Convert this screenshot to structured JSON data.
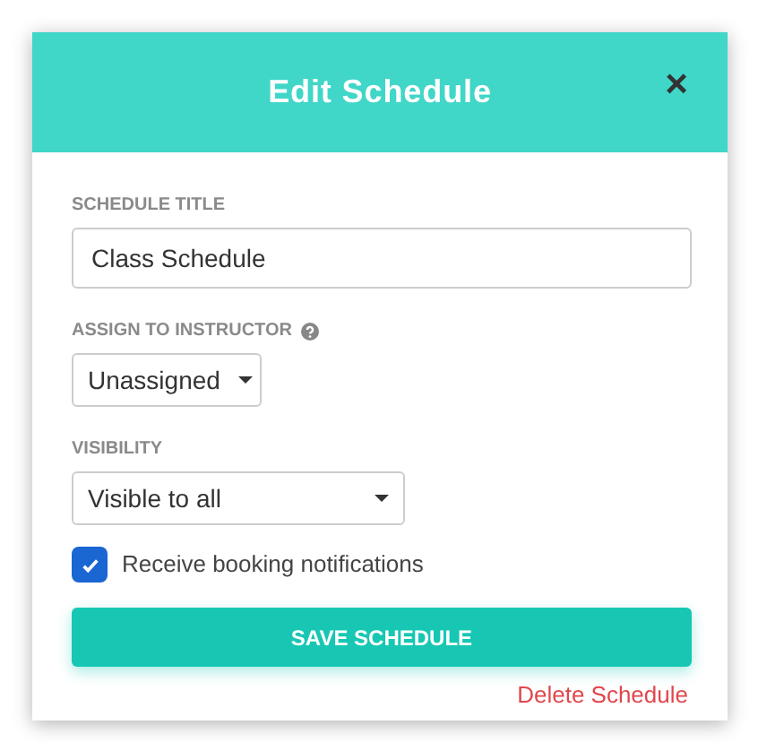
{
  "dialog": {
    "title": "Edit Schedule",
    "close": "×"
  },
  "fields": [
    {
      "kind": "text",
      "label": "SCHEDULE TITLE",
      "value": "Class Schedule"
    },
    {
      "kind": "select",
      "label": "ASSIGN TO INSTRUCTOR",
      "help": true,
      "value": "Unassigned"
    },
    {
      "kind": "select",
      "label": "VISIBILITY",
      "help": false,
      "value": "Visible to all"
    }
  ],
  "checkbox": {
    "label": "Receive booking notifications",
    "checked": true
  },
  "save_button": "SAVE SCHEDULE",
  "delete_link": "Delete Schedule"
}
